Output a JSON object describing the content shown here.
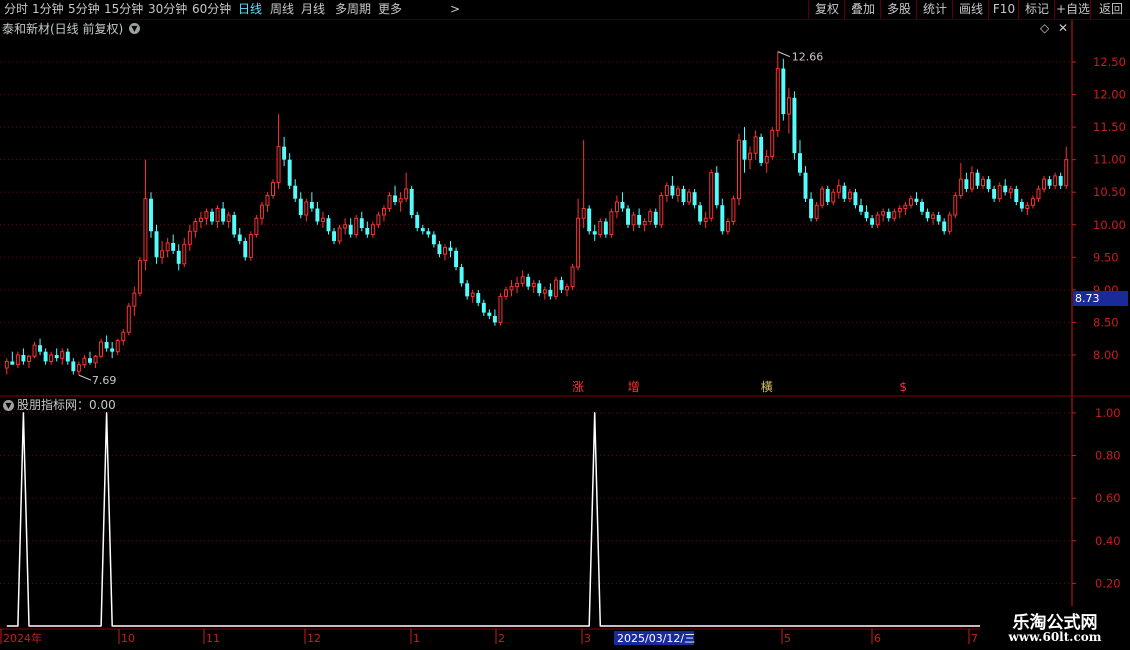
{
  "toolbar": {
    "periods": [
      "分时",
      "1分钟",
      "5分钟",
      "15分钟",
      "30分钟",
      "60分钟",
      "日线",
      "周线",
      "月线",
      "多周期",
      "更多"
    ],
    "active_period": "日线",
    "right_buttons": [
      "复权",
      "叠加",
      "多股",
      "统计",
      "画线",
      "F10",
      "标记",
      "+自选",
      "返回"
    ]
  },
  "main_title": "泰和新材(日线 前复权)",
  "sub_title": "股朋指标网：0.00",
  "price_tag": "8.73",
  "max_label": "12.66",
  "min_label": "7.69",
  "signals": [
    "涨",
    "增",
    "橫",
    "$"
  ],
  "date_highlight": "2025/03/12/三",
  "watermark": {
    "line1": "乐淘公式网",
    "line2": "www.60lt.com"
  },
  "colors": {
    "up": "#ff3030",
    "down": "#54fcfc",
    "grid": "#7a0000",
    "axis": "#c81e1e",
    "bg": "#000000"
  },
  "chart_data": [
    {
      "type": "candlestick",
      "y_ticks": [
        8.0,
        8.5,
        9.0,
        9.5,
        10.0,
        10.5,
        11.0,
        11.5,
        12.0,
        12.5
      ],
      "ylim": [
        7.4,
        12.9
      ],
      "x_labels": [
        "2024年",
        "10",
        "11",
        "12",
        "1",
        "2",
        "3",
        "5",
        "6",
        "7"
      ],
      "annotations": {
        "max": 12.66,
        "min": 7.69
      },
      "ohlc": [
        [
          7.8,
          7.95,
          7.7,
          7.9
        ],
        [
          7.9,
          8.05,
          7.85,
          7.85
        ],
        [
          7.85,
          8.05,
          7.8,
          8.0
        ],
        [
          8.0,
          8.1,
          7.85,
          7.9
        ],
        [
          7.9,
          8.0,
          7.8,
          7.98
        ],
        [
          7.98,
          8.2,
          7.95,
          8.15
        ],
        [
          8.15,
          8.25,
          8.0,
          8.05
        ],
        [
          8.05,
          8.1,
          7.85,
          7.9
        ],
        [
          7.9,
          8.05,
          7.85,
          8.0
        ],
        [
          8.0,
          8.1,
          7.9,
          7.95
        ],
        [
          7.95,
          8.1,
          7.85,
          8.05
        ],
        [
          8.05,
          8.1,
          7.85,
          7.9
        ],
        [
          7.9,
          7.95,
          7.7,
          7.75
        ],
        [
          7.75,
          7.9,
          7.69,
          7.85
        ],
        [
          7.85,
          8.0,
          7.8,
          7.95
        ],
        [
          7.95,
          8.05,
          7.85,
          7.88
        ],
        [
          7.88,
          8.0,
          7.8,
          7.98
        ],
        [
          7.98,
          8.25,
          7.95,
          8.2
        ],
        [
          8.2,
          8.3,
          8.05,
          8.1
        ],
        [
          8.1,
          8.2,
          7.95,
          8.05
        ],
        [
          8.05,
          8.25,
          8.0,
          8.22
        ],
        [
          8.22,
          8.4,
          8.15,
          8.35
        ],
        [
          8.35,
          8.8,
          8.3,
          8.75
        ],
        [
          8.75,
          9.05,
          8.6,
          8.95
        ],
        [
          8.95,
          9.5,
          8.9,
          9.45
        ],
        [
          9.45,
          11.0,
          9.3,
          10.4
        ],
        [
          10.4,
          10.5,
          9.8,
          9.9
        ],
        [
          9.9,
          10.0,
          9.4,
          9.5
        ],
        [
          9.5,
          9.75,
          9.4,
          9.6
        ],
        [
          9.6,
          9.8,
          9.5,
          9.72
        ],
        [
          9.72,
          9.85,
          9.55,
          9.6
        ],
        [
          9.6,
          9.7,
          9.3,
          9.4
        ],
        [
          9.4,
          9.8,
          9.35,
          9.7
        ],
        [
          9.7,
          10.0,
          9.6,
          9.9
        ],
        [
          9.9,
          10.1,
          9.8,
          10.05
        ],
        [
          10.05,
          10.2,
          9.95,
          10.1
        ],
        [
          10.1,
          10.25,
          10.0,
          10.2
        ],
        [
          10.2,
          10.25,
          10.0,
          10.05
        ],
        [
          10.05,
          10.3,
          9.95,
          10.25
        ],
        [
          10.25,
          10.35,
          10.0,
          10.05
        ],
        [
          10.05,
          10.2,
          9.95,
          10.15
        ],
        [
          10.15,
          10.2,
          9.8,
          9.85
        ],
        [
          9.85,
          9.95,
          9.7,
          9.75
        ],
        [
          9.75,
          9.8,
          9.45,
          9.5
        ],
        [
          9.5,
          9.9,
          9.45,
          9.85
        ],
        [
          9.85,
          10.15,
          9.8,
          10.1
        ],
        [
          10.1,
          10.35,
          10.0,
          10.3
        ],
        [
          10.3,
          10.5,
          10.2,
          10.45
        ],
        [
          10.45,
          10.7,
          10.4,
          10.65
        ],
        [
          10.65,
          11.7,
          10.55,
          11.2
        ],
        [
          11.2,
          11.35,
          10.9,
          11.0
        ],
        [
          11.0,
          11.1,
          10.55,
          10.6
        ],
        [
          10.6,
          10.7,
          10.35,
          10.4
        ],
        [
          10.4,
          10.5,
          10.1,
          10.15
        ],
        [
          10.15,
          10.4,
          10.05,
          10.35
        ],
        [
          10.35,
          10.5,
          10.2,
          10.25
        ],
        [
          10.25,
          10.35,
          10.0,
          10.05
        ],
        [
          10.05,
          10.2,
          9.95,
          10.1
        ],
        [
          10.1,
          10.15,
          9.85,
          9.9
        ],
        [
          9.9,
          9.95,
          9.7,
          9.75
        ],
        [
          9.75,
          10.0,
          9.7,
          9.95
        ],
        [
          9.95,
          10.1,
          9.85,
          10.0
        ],
        [
          10.0,
          10.1,
          9.8,
          9.85
        ],
        [
          9.85,
          10.15,
          9.8,
          10.1
        ],
        [
          10.1,
          10.2,
          9.9,
          9.95
        ],
        [
          9.95,
          10.05,
          9.8,
          9.85
        ],
        [
          9.85,
          10.05,
          9.8,
          10.0
        ],
        [
          10.0,
          10.2,
          9.95,
          10.15
        ],
        [
          10.15,
          10.3,
          10.05,
          10.25
        ],
        [
          10.25,
          10.5,
          10.2,
          10.45
        ],
        [
          10.45,
          10.6,
          10.3,
          10.35
        ],
        [
          10.35,
          10.5,
          10.2,
          10.4
        ],
        [
          10.4,
          10.8,
          10.35,
          10.55
        ],
        [
          10.55,
          10.6,
          10.1,
          10.15
        ],
        [
          10.15,
          10.2,
          9.9,
          9.95
        ],
        [
          9.95,
          10.0,
          9.85,
          9.9
        ],
        [
          9.9,
          9.95,
          9.8,
          9.85
        ],
        [
          9.85,
          9.9,
          9.65,
          9.7
        ],
        [
          9.7,
          9.75,
          9.5,
          9.55
        ],
        [
          9.55,
          9.7,
          9.45,
          9.65
        ],
        [
          9.65,
          9.75,
          9.5,
          9.6
        ],
        [
          9.6,
          9.65,
          9.3,
          9.35
        ],
        [
          9.35,
          9.4,
          9.05,
          9.1
        ],
        [
          9.1,
          9.15,
          8.85,
          8.9
        ],
        [
          8.9,
          9.0,
          8.8,
          8.95
        ],
        [
          8.95,
          9.0,
          8.75,
          8.8
        ],
        [
          8.8,
          8.85,
          8.6,
          8.65
        ],
        [
          8.65,
          8.7,
          8.55,
          8.6
        ],
        [
          8.6,
          8.7,
          8.45,
          8.5
        ],
        [
          8.5,
          8.95,
          8.45,
          8.9
        ],
        [
          8.9,
          9.05,
          8.85,
          9.0
        ],
        [
          9.0,
          9.15,
          8.9,
          9.05
        ],
        [
          9.05,
          9.2,
          8.95,
          9.1
        ],
        [
          9.1,
          9.3,
          9.05,
          9.2
        ],
        [
          9.2,
          9.25,
          9.0,
          9.05
        ],
        [
          9.05,
          9.15,
          8.95,
          9.1
        ],
        [
          9.1,
          9.15,
          8.9,
          8.95
        ],
        [
          8.95,
          9.05,
          8.85,
          9.0
        ],
        [
          9.0,
          9.1,
          8.85,
          8.9
        ],
        [
          8.9,
          9.2,
          8.85,
          9.15
        ],
        [
          9.15,
          9.2,
          8.95,
          9.0
        ],
        [
          9.0,
          9.1,
          8.9,
          9.05
        ],
        [
          9.05,
          9.4,
          9.0,
          9.35
        ],
        [
          9.35,
          10.4,
          9.3,
          10.1
        ],
        [
          10.1,
          11.3,
          9.95,
          10.25
        ],
        [
          10.25,
          10.3,
          9.85,
          9.9
        ],
        [
          9.9,
          10.0,
          9.75,
          9.85
        ],
        [
          9.85,
          10.1,
          9.8,
          10.05
        ],
        [
          10.05,
          10.1,
          9.8,
          9.85
        ],
        [
          9.85,
          10.25,
          9.8,
          10.2
        ],
        [
          10.2,
          10.45,
          10.1,
          10.35
        ],
        [
          10.35,
          10.5,
          10.2,
          10.25
        ],
        [
          10.25,
          10.3,
          9.95,
          10.0
        ],
        [
          10.0,
          10.2,
          9.9,
          10.15
        ],
        [
          10.15,
          10.25,
          9.95,
          10.0
        ],
        [
          10.0,
          10.1,
          9.9,
          10.05
        ],
        [
          10.05,
          10.25,
          10.0,
          10.2
        ],
        [
          10.2,
          10.25,
          9.95,
          10.0
        ],
        [
          10.0,
          10.5,
          9.95,
          10.45
        ],
        [
          10.45,
          10.65,
          10.35,
          10.6
        ],
        [
          10.6,
          10.75,
          10.4,
          10.45
        ],
        [
          10.45,
          10.6,
          10.35,
          10.55
        ],
        [
          10.55,
          10.6,
          10.3,
          10.35
        ],
        [
          10.35,
          10.55,
          10.3,
          10.5
        ],
        [
          10.5,
          10.55,
          10.25,
          10.3
        ],
        [
          10.3,
          10.35,
          10.0,
          10.05
        ],
        [
          10.05,
          10.2,
          9.95,
          10.1
        ],
        [
          10.1,
          10.85,
          10.05,
          10.8
        ],
        [
          10.8,
          10.9,
          10.25,
          10.3
        ],
        [
          10.3,
          10.4,
          9.85,
          9.9
        ],
        [
          9.9,
          10.1,
          9.85,
          10.05
        ],
        [
          10.05,
          10.45,
          10.0,
          10.4
        ],
        [
          10.4,
          11.4,
          10.3,
          11.3
        ],
        [
          11.3,
          11.5,
          10.8,
          11.0
        ],
        [
          11.0,
          11.2,
          10.85,
          11.1
        ],
        [
          11.1,
          11.45,
          11.0,
          11.35
        ],
        [
          11.35,
          11.4,
          10.9,
          10.95
        ],
        [
          10.95,
          11.15,
          10.8,
          11.05
        ],
        [
          11.05,
          11.5,
          11.0,
          11.45
        ],
        [
          11.45,
          12.66,
          11.35,
          12.4
        ],
        [
          12.4,
          12.55,
          11.6,
          11.7
        ],
        [
          11.7,
          12.1,
          11.4,
          11.95
        ],
        [
          11.95,
          12.05,
          11.0,
          11.1
        ],
        [
          11.1,
          11.3,
          10.75,
          10.8
        ],
        [
          10.8,
          10.9,
          10.35,
          10.4
        ],
        [
          10.4,
          10.5,
          10.05,
          10.1
        ],
        [
          10.1,
          10.35,
          10.05,
          10.3
        ],
        [
          10.3,
          10.6,
          10.25,
          10.55
        ],
        [
          10.55,
          10.6,
          10.3,
          10.35
        ],
        [
          10.35,
          10.55,
          10.3,
          10.5
        ],
        [
          10.5,
          10.7,
          10.4,
          10.6
        ],
        [
          10.6,
          10.65,
          10.35,
          10.4
        ],
        [
          10.4,
          10.55,
          10.35,
          10.5
        ],
        [
          10.5,
          10.55,
          10.25,
          10.3
        ],
        [
          10.3,
          10.4,
          10.15,
          10.2
        ],
        [
          10.2,
          10.3,
          10.05,
          10.1
        ],
        [
          10.1,
          10.15,
          9.95,
          10.0
        ],
        [
          10.0,
          10.2,
          9.95,
          10.15
        ],
        [
          10.15,
          10.25,
          10.05,
          10.2
        ],
        [
          10.2,
          10.25,
          10.05,
          10.1
        ],
        [
          10.1,
          10.25,
          10.05,
          10.2
        ],
        [
          10.2,
          10.3,
          10.1,
          10.25
        ],
        [
          10.25,
          10.35,
          10.15,
          10.3
        ],
        [
          10.3,
          10.45,
          10.25,
          10.4
        ],
        [
          10.4,
          10.5,
          10.3,
          10.35
        ],
        [
          10.35,
          10.4,
          10.15,
          10.2
        ],
        [
          10.2,
          10.25,
          10.05,
          10.1
        ],
        [
          10.1,
          10.2,
          10.0,
          10.15
        ],
        [
          10.15,
          10.2,
          10.0,
          10.05
        ],
        [
          10.05,
          10.1,
          9.85,
          9.9
        ],
        [
          9.9,
          10.2,
          9.85,
          10.15
        ],
        [
          10.15,
          10.5,
          10.1,
          10.45
        ],
        [
          10.45,
          10.95,
          10.4,
          10.7
        ],
        [
          10.7,
          10.8,
          10.5,
          10.55
        ],
        [
          10.55,
          10.9,
          10.5,
          10.8
        ],
        [
          10.8,
          10.85,
          10.55,
          10.6
        ],
        [
          10.6,
          10.75,
          10.55,
          10.7
        ],
        [
          10.7,
          10.75,
          10.5,
          10.55
        ],
        [
          10.55,
          10.6,
          10.35,
          10.4
        ],
        [
          10.4,
          10.65,
          10.35,
          10.6
        ],
        [
          10.6,
          10.7,
          10.45,
          10.5
        ],
        [
          10.5,
          10.6,
          10.4,
          10.55
        ],
        [
          10.55,
          10.6,
          10.3,
          10.35
        ],
        [
          10.35,
          10.4,
          10.2,
          10.25
        ],
        [
          10.25,
          10.35,
          10.15,
          10.3
        ],
        [
          10.3,
          10.45,
          10.25,
          10.4
        ],
        [
          10.4,
          10.6,
          10.35,
          10.55
        ],
        [
          10.55,
          10.75,
          10.5,
          10.7
        ],
        [
          10.7,
          10.75,
          10.55,
          10.6
        ],
        [
          10.6,
          10.8,
          10.55,
          10.75
        ],
        [
          10.75,
          10.8,
          10.55,
          10.6
        ],
        [
          10.6,
          11.2,
          10.55,
          11.0
        ]
      ]
    },
    {
      "type": "line",
      "y_ticks": [
        0.2,
        0.4,
        0.6,
        0.8,
        1.0
      ],
      "ylim": [
        0,
        1.07
      ],
      "spikes_at_index": [
        3,
        18,
        106
      ],
      "values_note": ""
    }
  ]
}
